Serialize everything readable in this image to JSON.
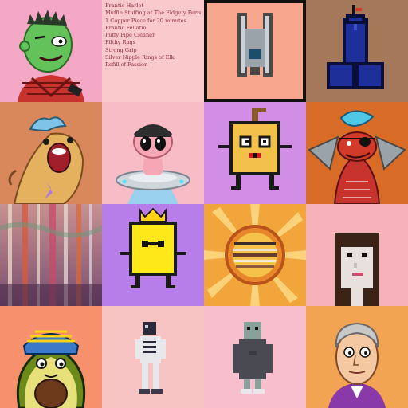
{
  "text_tile": {
    "lines": [
      "Frantic Harlot",
      "Muffin Stuffing at The Fidgety Ferret",
      "1 Copper Piece for 20 minutes",
      "Frantic Fellatio",
      "Puffy Pipe Cleaner",
      "Filthy Rags",
      "Strong Grip",
      "Silver Nipple Rings of Elk",
      "Refill of Passion"
    ]
  },
  "tile_backgrounds": {
    "zombie": "#f5a8c6",
    "text": "#f9c9cc",
    "pixel_robot": "#f7a78d",
    "pixel_phallus": "#a6785a",
    "fish": "#d8885a",
    "alien_ufo": "#f7bcc5",
    "toast": "#d28de6",
    "dragon": "#d86b25",
    "forest": "#a06a6a",
    "crown_block": "#b77de8",
    "sun": "#f2a53a",
    "pixel_lady": "#f6b2b8",
    "avocado": "#f6906d",
    "pixel_skeleton": "#f7c3c3",
    "pixel_hoodie": "#f7bfcd",
    "old_man": "#f3a452"
  }
}
